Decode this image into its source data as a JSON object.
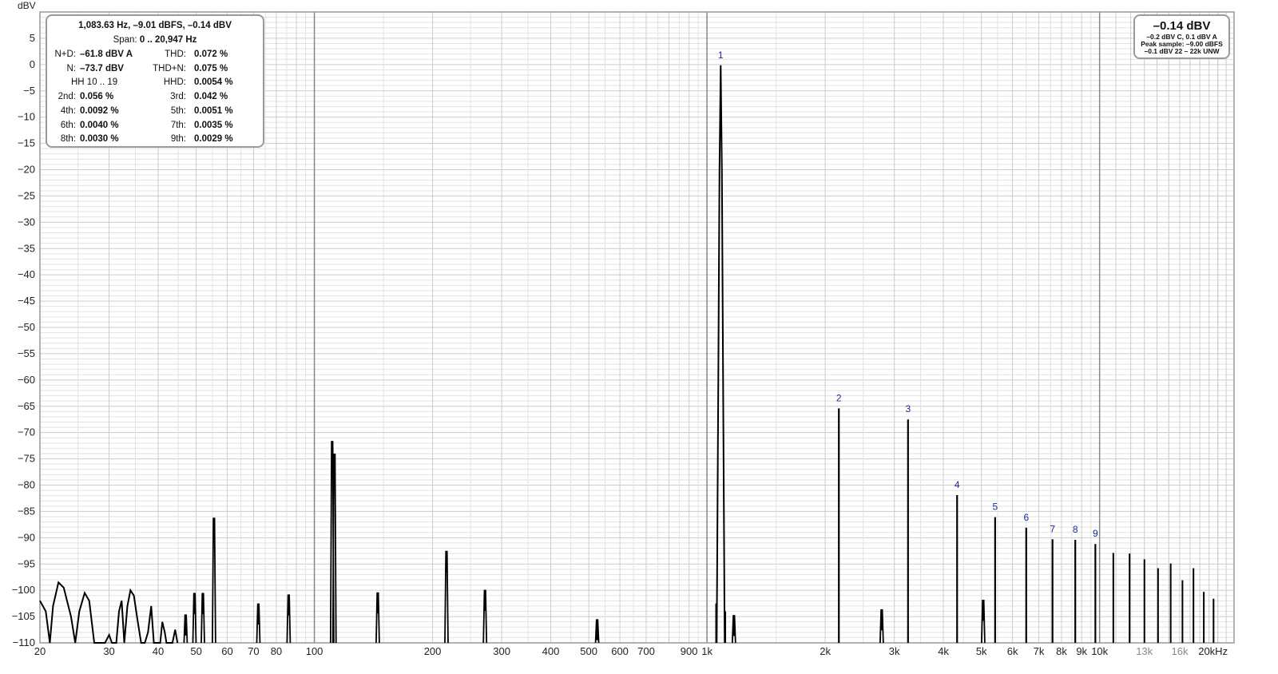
{
  "chart_data": {
    "type": "line",
    "title": "",
    "ylabel": "dBV",
    "xlabel": "",
    "x_scale": "log",
    "xlim": [
      20,
      22000
    ],
    "ylim": [
      -110,
      10
    ],
    "grid": true,
    "y_ticks": [
      5,
      0,
      -5,
      -10,
      -15,
      -20,
      -25,
      -30,
      -35,
      -40,
      -45,
      -50,
      -55,
      -60,
      -65,
      -70,
      -75,
      -80,
      -85,
      -90,
      -95,
      -100,
      -105,
      -110
    ],
    "x_ticks": [
      {
        "value": 20,
        "label": "20"
      },
      {
        "value": 30,
        "label": "30"
      },
      {
        "value": 40,
        "label": "40"
      },
      {
        "value": 50,
        "label": "50"
      },
      {
        "value": 60,
        "label": "60"
      },
      {
        "value": 70,
        "label": "70"
      },
      {
        "value": 80,
        "label": "80"
      },
      {
        "value": 100,
        "label": "100"
      },
      {
        "value": 200,
        "label": "200"
      },
      {
        "value": 300,
        "label": "300"
      },
      {
        "value": 400,
        "label": "400"
      },
      {
        "value": 500,
        "label": "500"
      },
      {
        "value": 600,
        "label": "600"
      },
      {
        "value": 700,
        "label": "700"
      },
      {
        "value": 900,
        "label": "900"
      },
      {
        "value": 1000,
        "label": "1k"
      },
      {
        "value": 2000,
        "label": "2k"
      },
      {
        "value": 3000,
        "label": "3k"
      },
      {
        "value": 4000,
        "label": "4k"
      },
      {
        "value": 5000,
        "label": "5k"
      },
      {
        "value": 6000,
        "label": "6k"
      },
      {
        "value": 7000,
        "label": "7k"
      },
      {
        "value": 8000,
        "label": "8k"
      },
      {
        "value": 9000,
        "label": "9k"
      },
      {
        "value": 10000,
        "label": "10k"
      },
      {
        "value": 13000,
        "label": "13k",
        "minor": true
      },
      {
        "value": 16000,
        "label": "16k",
        "minor": true
      },
      {
        "value": 20000,
        "label": "20kHz"
      }
    ],
    "harmonics": [
      {
        "label": "1",
        "x": 1083.63,
        "y": -0.14
      },
      {
        "label": "2",
        "x": 2167,
        "y": -65.4
      },
      {
        "label": "3",
        "x": 3251,
        "y": -67.5
      },
      {
        "label": "4",
        "x": 4335,
        "y": -81.9
      },
      {
        "label": "5",
        "x": 5418,
        "y": -86.1
      },
      {
        "label": "6",
        "x": 6502,
        "y": -88.1
      },
      {
        "label": "7",
        "x": 7585,
        "y": -90.3
      },
      {
        "label": "8",
        "x": 8669,
        "y": -90.4
      },
      {
        "label": "9",
        "x": 9753,
        "y": -91.2
      }
    ],
    "upper_harmonics": [
      {
        "x": 10836,
        "y": -92.9
      },
      {
        "x": 11920,
        "y": -93.0
      },
      {
        "x": 13004,
        "y": -94.1
      },
      {
        "x": 14087,
        "y": -95.8
      },
      {
        "x": 15171,
        "y": -94.9
      },
      {
        "x": 16255,
        "y": -98.1
      },
      {
        "x": 17338,
        "y": -95.8
      },
      {
        "x": 18422,
        "y": -100.3
      },
      {
        "x": 19506,
        "y": -101.6
      }
    ],
    "spurs": [
      {
        "x": 55.5,
        "y": -90.2
      },
      {
        "x": 111,
        "y": -75.6
      },
      {
        "x": 112.5,
        "y": -78
      },
      {
        "x": 86,
        "y": -104.8
      },
      {
        "x": 72,
        "y": -106.5
      },
      {
        "x": 52,
        "y": -104.5
      },
      {
        "x": 49.5,
        "y": -104.5
      },
      {
        "x": 47,
        "y": -108.6
      },
      {
        "x": 145,
        "y": -104.4
      },
      {
        "x": 217,
        "y": -96.5
      },
      {
        "x": 272,
        "y": -103.9
      },
      {
        "x": 525,
        "y": -109.5
      },
      {
        "x": 1171,
        "y": -108.7
      },
      {
        "x": 2786,
        "y": -107.6
      },
      {
        "x": 5052,
        "y": -105.8
      }
    ],
    "low_noise": [
      {
        "x": 20,
        "y": -102
      },
      {
        "x": 20.7,
        "y": -104
      },
      {
        "x": 21.2,
        "y": -110
      },
      {
        "x": 21.6,
        "y": -103
      },
      {
        "x": 22.3,
        "y": -98.5
      },
      {
        "x": 23,
        "y": -99.5
      },
      {
        "x": 24,
        "y": -105
      },
      {
        "x": 24.6,
        "y": -110
      },
      {
        "x": 25.2,
        "y": -104
      },
      {
        "x": 26,
        "y": -100.5
      },
      {
        "x": 26.7,
        "y": -102
      },
      {
        "x": 27.5,
        "y": -110
      },
      {
        "x": 29.3,
        "y": -110
      },
      {
        "x": 30,
        "y": -108.5
      },
      {
        "x": 30.5,
        "y": -110
      },
      {
        "x": 31.3,
        "y": -110
      },
      {
        "x": 31.8,
        "y": -104
      },
      {
        "x": 32.3,
        "y": -102
      },
      {
        "x": 32.8,
        "y": -110
      },
      {
        "x": 33.4,
        "y": -103
      },
      {
        "x": 34,
        "y": -100
      },
      {
        "x": 34.7,
        "y": -101
      },
      {
        "x": 35.5,
        "y": -106
      },
      {
        "x": 36.2,
        "y": -110
      },
      {
        "x": 37,
        "y": -110
      },
      {
        "x": 37.7,
        "y": -108
      },
      {
        "x": 38.4,
        "y": -103
      },
      {
        "x": 39,
        "y": -110
      },
      {
        "x": 40.5,
        "y": -110
      },
      {
        "x": 41,
        "y": -106
      },
      {
        "x": 41.6,
        "y": -108
      },
      {
        "x": 42,
        "y": -110
      },
      {
        "x": 43.5,
        "y": -110
      },
      {
        "x": 44.2,
        "y": -107.5
      },
      {
        "x": 44.8,
        "y": -110
      }
    ]
  },
  "readout": {
    "header": "1,083.63 Hz, –9.01 dBFS, –0.14 dBV",
    "span_label": "Span:",
    "span_value": "0 .. 20,947 Hz",
    "rows": [
      {
        "l1": "N+D:",
        "v1": "–61.8 dBV A",
        "l2": "THD:",
        "v2": "0.072 %"
      },
      {
        "l1": "N:",
        "v1": "–73.7 dBV",
        "l2": "THD+N:",
        "v2": "0.075 %"
      },
      {
        "l1": "HH 10 .. 19",
        "v1": "",
        "l2": "HHD:",
        "v2": "0.0054 %"
      },
      {
        "l1": "2nd:",
        "v1": "0.056 %",
        "l2": "3rd:",
        "v2": "0.042 %"
      },
      {
        "l1": "4th:",
        "v1": "0.0092 %",
        "l2": "5th:",
        "v2": "0.0051 %"
      },
      {
        "l1": "6th:",
        "v1": "0.0040 %",
        "l2": "7th:",
        "v2": "0.0035 %"
      },
      {
        "l1": "8th:",
        "v1": "0.0030 %",
        "l2": "9th:",
        "v2": "0.0029 %"
      }
    ]
  },
  "level": {
    "main": "–0.14 dBV",
    "line1": "–0.2 dBV C, 0.1 dBV A",
    "line2": "Peak sample: –9.00 dBFS",
    "line3": "–0.1 dBV 22 – 22k UNW"
  },
  "colors": {
    "trace": "#000000",
    "harmonic_label": "#1a2a9c",
    "grid_minor": "#e2e2e2",
    "grid_major": "#cccccc",
    "grid_decade": "#888888",
    "frame": "#999999"
  }
}
